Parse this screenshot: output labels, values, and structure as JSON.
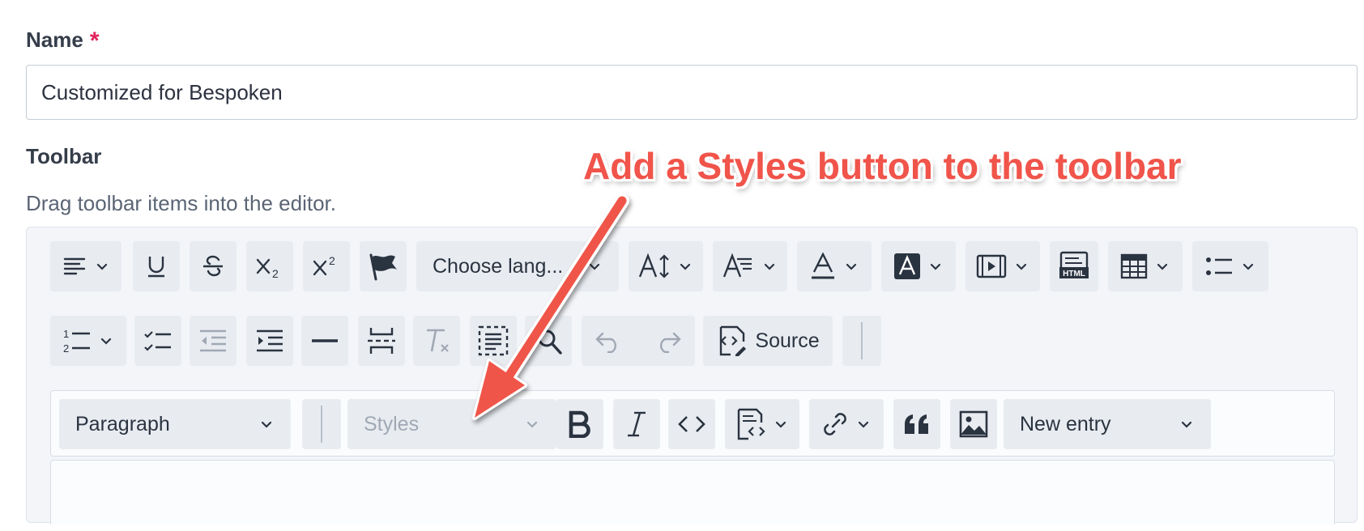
{
  "form": {
    "name_label": "Name",
    "required_mark": "*",
    "name_value": "Customized for Bespoken",
    "toolbar_label": "Toolbar",
    "toolbar_help": "Drag toolbar items into the editor."
  },
  "available_items": {
    "language_dropdown": "Choose lang...",
    "source_button": "Source"
  },
  "editor_toolbar": {
    "heading_dropdown": "Paragraph",
    "styles_dropdown": "Styles",
    "entity_dropdown": "New entry"
  },
  "annotation": {
    "text": "Add a Styles button to the toolbar",
    "color": "#f0544a"
  },
  "icons": [
    "align-icon",
    "underline-icon",
    "strikethrough-icon",
    "subscript-icon",
    "superscript-icon",
    "flag-icon",
    "font-size-icon",
    "font-family-icon",
    "font-color-icon",
    "font-background-icon",
    "media-icon",
    "html-embed-icon",
    "table-icon",
    "bulleted-list-icon",
    "numbered-list-icon",
    "todo-list-icon",
    "outdent-icon",
    "indent-icon",
    "horizontal-line-icon",
    "page-break-icon",
    "remove-format-icon",
    "select-all-icon",
    "find-replace-icon",
    "undo-icon",
    "redo-icon",
    "source-icon",
    "bold-icon",
    "italic-icon",
    "code-icon",
    "code-block-icon",
    "link-icon",
    "blockquote-icon",
    "image-icon"
  ]
}
